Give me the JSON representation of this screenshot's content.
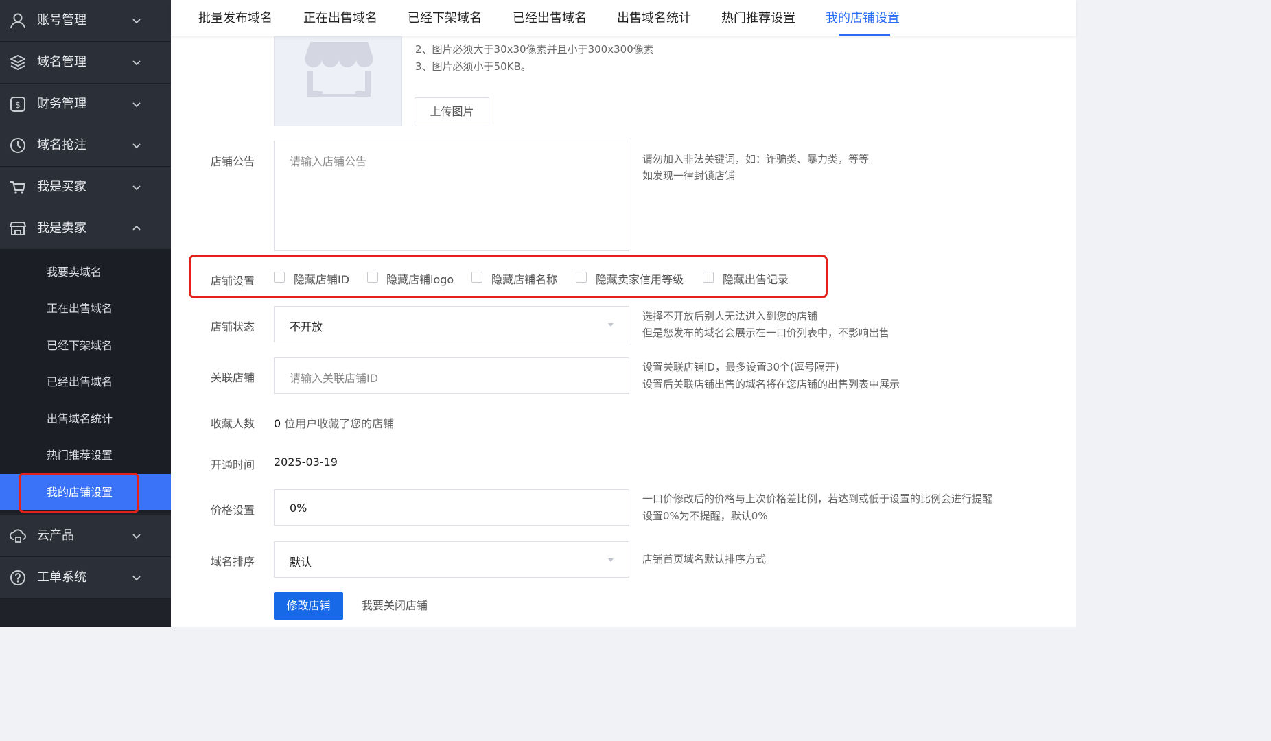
{
  "sidebar": {
    "groups": [
      {
        "label": "账号管理",
        "icon": "user-icon"
      },
      {
        "label": "域名管理",
        "icon": "layers-icon"
      },
      {
        "label": "财务管理",
        "icon": "dollar-wallet-icon"
      },
      {
        "label": "域名抢注",
        "icon": "clock-icon"
      },
      {
        "label": "我是买家",
        "icon": "cart-icon"
      },
      {
        "label": "我是卖家",
        "icon": "store-icon",
        "expanded": true
      },
      {
        "label": "云产品",
        "icon": "cloud-icon"
      },
      {
        "label": "工单系统",
        "icon": "help-circle-icon"
      }
    ],
    "seller_items": [
      "我要卖域名",
      "正在出售域名",
      "已经下架域名",
      "已经出售域名",
      "出售域名统计",
      "热门推荐设置",
      "我的店铺设置"
    ],
    "active_item": "我的店铺设置"
  },
  "tabs": [
    "批量发布域名",
    "正在出售域名",
    "已经下架域名",
    "已经出售域名",
    "出售域名统计",
    "热门推荐设置",
    "我的店铺设置"
  ],
  "active_tab": "我的店铺设置",
  "logo_section": {
    "rules": [
      "2、图片必须大于30x30像素并且小于300x300像素",
      "3、图片必须小于50KB。"
    ],
    "upload_button": "上传图片"
  },
  "announcement": {
    "label": "店铺公告",
    "placeholder": "请输入店铺公告",
    "hint": [
      "请勿加入非法关键词，如：诈骗类、暴力类，等等",
      "如发现一律封锁店铺"
    ]
  },
  "settings": {
    "label": "店铺设置",
    "options": [
      "隐藏店铺ID",
      "隐藏店铺logo",
      "隐藏店铺名称",
      "隐藏卖家信用等级",
      "隐藏出售记录"
    ]
  },
  "status": {
    "label": "店铺状态",
    "value": "不开放",
    "hint": [
      "选择不开放后别人无法进入到您的店铺",
      "但是您发布的域名会展示在一口价列表中，不影响出售"
    ]
  },
  "linked": {
    "label": "关联店铺",
    "placeholder": "请输入关联店铺ID",
    "hint": [
      "设置关联店铺ID，最多设置30个(逗号隔开)",
      "设置后关联店铺出售的域名将在您店铺的出售列表中展示"
    ]
  },
  "favorites": {
    "label": "收藏人数",
    "count": "0",
    "text": "位用户收藏了您的店铺"
  },
  "opened": {
    "label": "开通时间",
    "value": "2025-03-19"
  },
  "price": {
    "label": "价格设置",
    "value": "0%",
    "hint": [
      "一口价修改后的价格与上次价格差比例，若达到或低于设置的比例会进行提醒",
      "设置0%为不提醒，默认0%"
    ]
  },
  "sort": {
    "label": "域名排序",
    "value": "默认",
    "hint": "店铺首页域名默认排序方式"
  },
  "actions": {
    "submit": "修改店铺",
    "close": "我要关闭店铺"
  },
  "colors": {
    "accent": "#2b6cf6",
    "highlight": "#e3231b",
    "sidebar_bg": "#1f2229",
    "active_bg": "#3a73f8"
  }
}
